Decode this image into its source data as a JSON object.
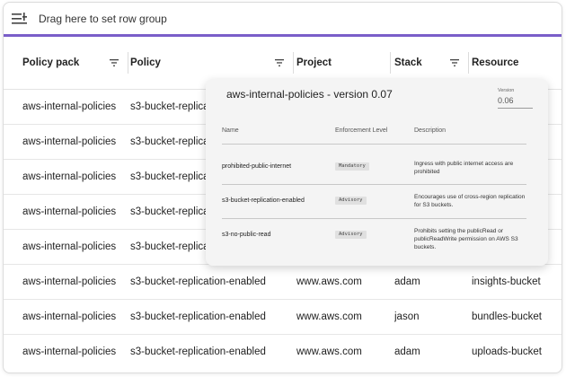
{
  "group_bar": {
    "icon": "row-group-icon",
    "text": "Drag here to set row group"
  },
  "columns": [
    {
      "label": "Policy pack",
      "icon": "filter-icon"
    },
    {
      "label": "Policy",
      "icon": "filter-icon"
    },
    {
      "label": "Project",
      "icon": "filter-icon"
    },
    {
      "label": "Stack",
      "icon": "filter-icon"
    },
    {
      "label": "Resource",
      "icon": ""
    }
  ],
  "rows": [
    {
      "policy_pack": "aws-internal-policies",
      "policy": "s3-bucket-replica",
      "project": "",
      "stack": "",
      "resource": ""
    },
    {
      "policy_pack": "aws-internal-policies",
      "policy": "s3-bucket-replica",
      "project": "",
      "stack": "",
      "resource": ""
    },
    {
      "policy_pack": "aws-internal-policies",
      "policy": "s3-bucket-replica",
      "project": "",
      "stack": "",
      "resource": ""
    },
    {
      "policy_pack": "aws-internal-policies",
      "policy": "s3-bucket-replica",
      "project": "",
      "stack": "",
      "resource": ""
    },
    {
      "policy_pack": "aws-internal-policies",
      "policy": "s3-bucket-replica",
      "project": "",
      "stack": "",
      "resource": ""
    },
    {
      "policy_pack": "aws-internal-policies",
      "policy": "s3-bucket-replication-enabled",
      "project": "www.aws.com",
      "stack": "adam",
      "resource": "insights-bucket"
    },
    {
      "policy_pack": "aws-internal-policies",
      "policy": "s3-bucket-replication-enabled",
      "project": "www.aws.com",
      "stack": "jason",
      "resource": "bundles-bucket"
    },
    {
      "policy_pack": "aws-internal-policies",
      "policy": "s3-bucket-replication-enabled",
      "project": "www.aws.com",
      "stack": "adam",
      "resource": "uploads-bucket"
    }
  ],
  "popup": {
    "title": "aws-internal-policies - version 0.07",
    "version_label": "Version",
    "version_value": "0.06",
    "headers": {
      "name": "Name",
      "enforcement": "Enforcement Level",
      "description": "Description"
    },
    "policies": [
      {
        "name": "prohibited-public-internet",
        "level": "Mandatory",
        "description": "Ingress with public internet access are prohibited"
      },
      {
        "name": "s3-bucket-replication-enabled",
        "level": "Advisory",
        "description": "Encourages use of cross-region replication for S3 buckets."
      },
      {
        "name": "s3-no-public-read",
        "level": "Advisory",
        "description": "Prohibits setting the publicRead or publicReadWrite permission on AWS S3 buckets."
      }
    ]
  },
  "colors": {
    "accent": "#7a5ec9"
  }
}
